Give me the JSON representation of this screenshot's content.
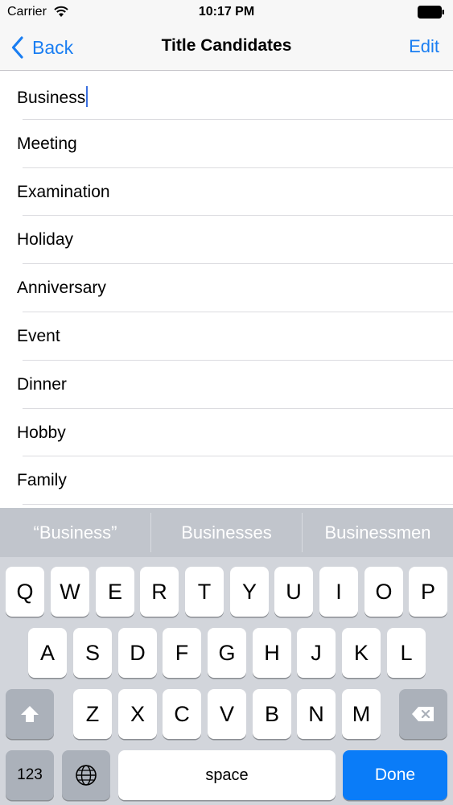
{
  "status_bar": {
    "carrier": "Carrier",
    "time": "10:17 PM",
    "wifi_icon": "wifi-icon",
    "battery_icon": "battery-icon"
  },
  "nav": {
    "back_label": "Back",
    "title": "Title Candidates",
    "edit_label": "Edit"
  },
  "list": {
    "items": [
      "Business",
      "Meeting",
      "Examination",
      "Holiday",
      "Anniversary",
      "Event",
      "Dinner",
      "Hobby",
      "Family"
    ],
    "editing_index": 0
  },
  "keyboard": {
    "predictions": [
      "“Business”",
      "Businesses",
      "Businessmen"
    ],
    "row1": [
      "Q",
      "W",
      "E",
      "R",
      "T",
      "Y",
      "U",
      "I",
      "O",
      "P"
    ],
    "row2": [
      "A",
      "S",
      "D",
      "F",
      "G",
      "H",
      "J",
      "K",
      "L"
    ],
    "row3": [
      "Z",
      "X",
      "C",
      "V",
      "B",
      "N",
      "M"
    ],
    "numbers_label": "123",
    "space_label": "space",
    "done_label": "Done",
    "shift_icon": "shift-icon",
    "delete_icon": "delete-icon",
    "globe_icon": "globe-icon"
  },
  "colors": {
    "accent": "#1a7ef2",
    "done_key": "#0a7cf8",
    "keyboard_bg": "#d2d5db",
    "prediction_bg": "#c1c5cc"
  }
}
